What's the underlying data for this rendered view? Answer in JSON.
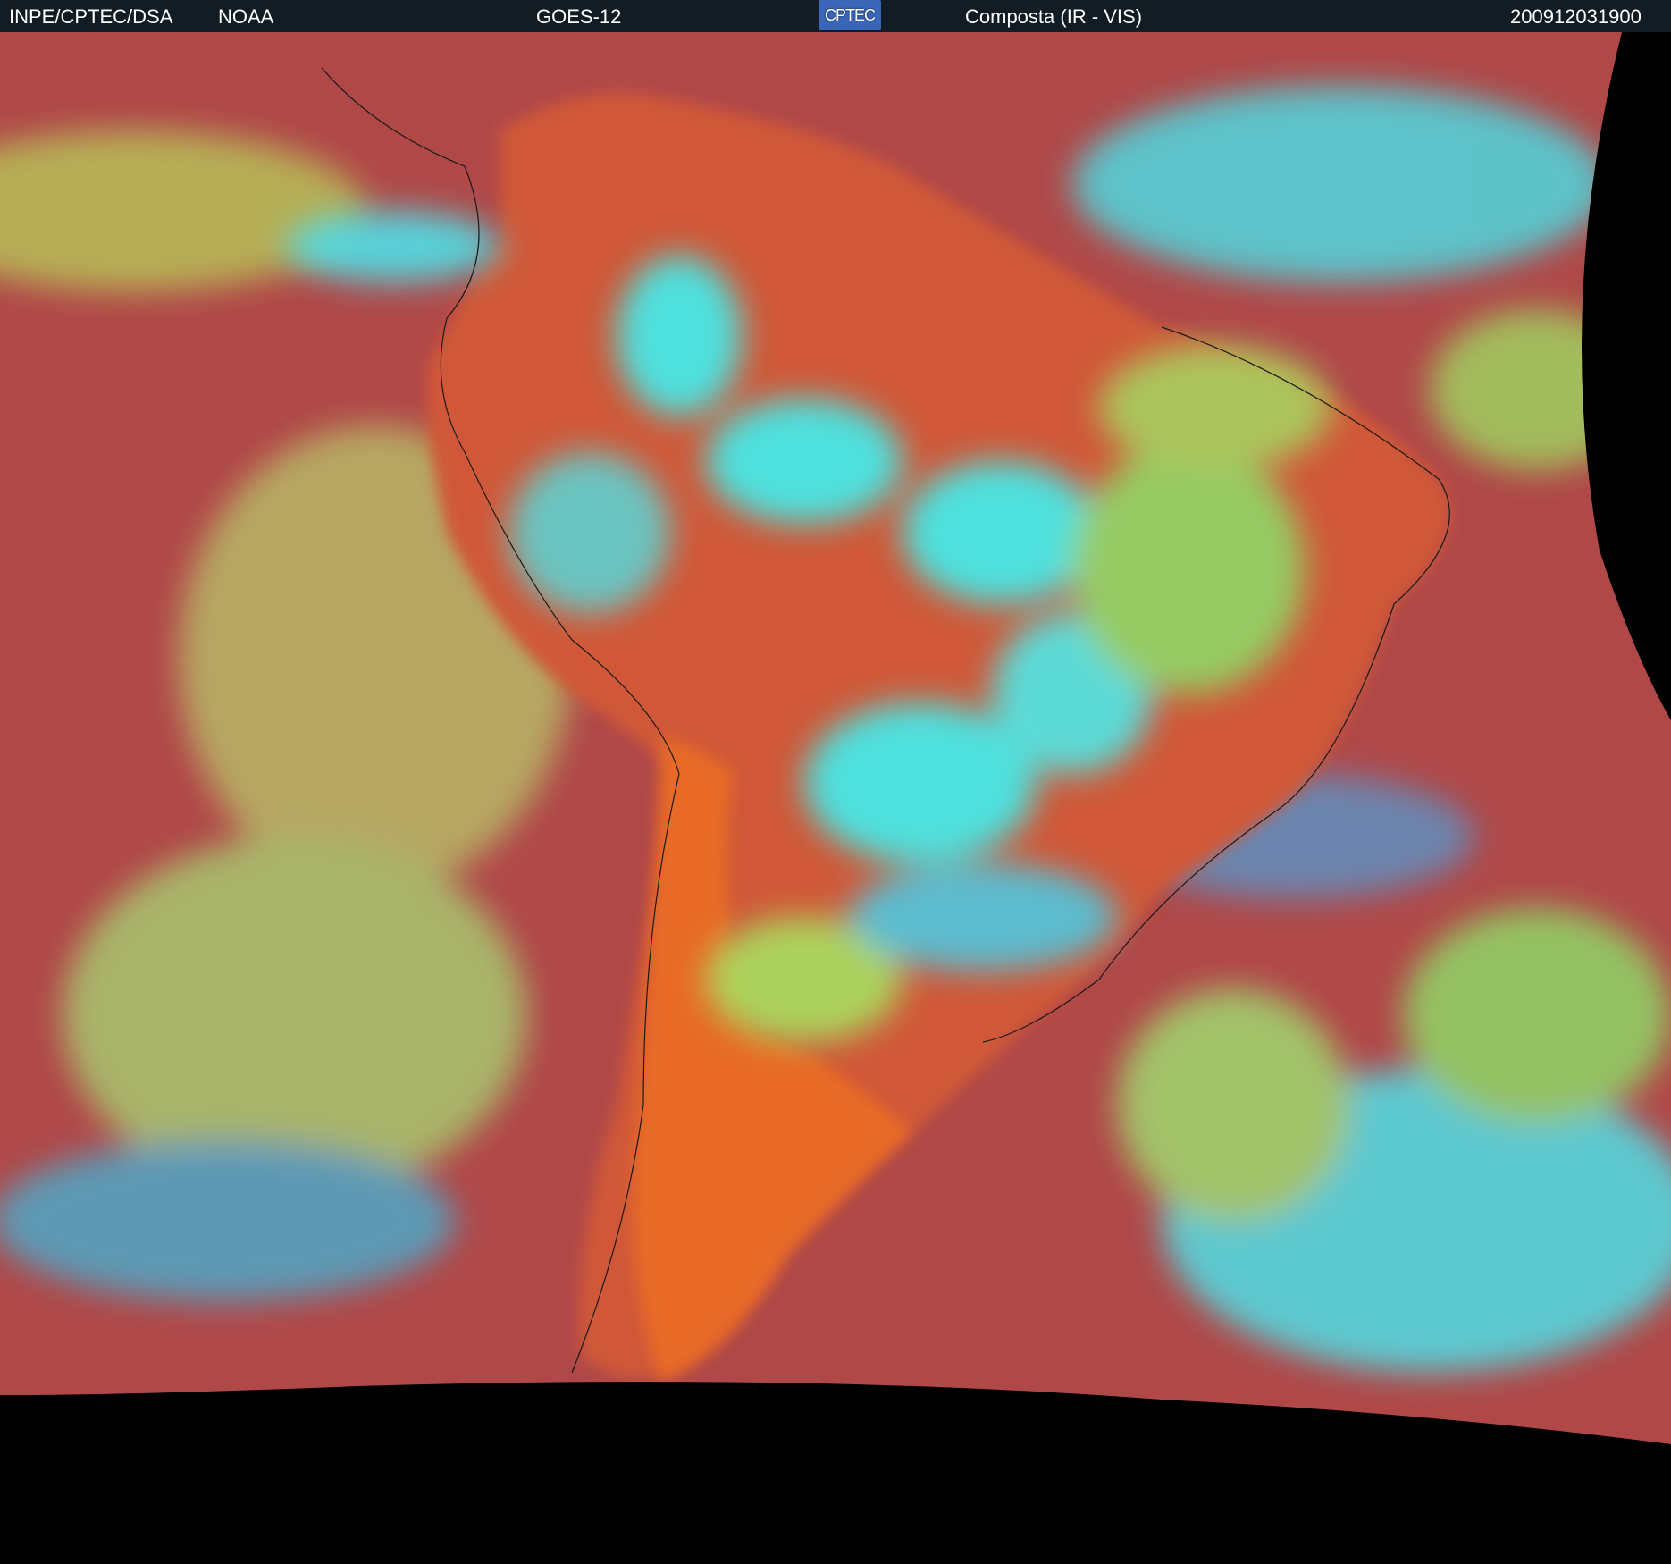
{
  "header": {
    "institution": "INPE/CPTEC/DSA",
    "agency": "NOAA",
    "satellite": "GOES-12",
    "logo_text": "CPTEC",
    "product": "Composta (IR - VIS)",
    "timestamp": "200912031900"
  },
  "colors": {
    "header_bg": "#111c24",
    "ocean_red": "#b04848",
    "land_orange": "#e06030",
    "cloud_green": "#a8e060",
    "cloud_cyan": "#40f0f0"
  }
}
